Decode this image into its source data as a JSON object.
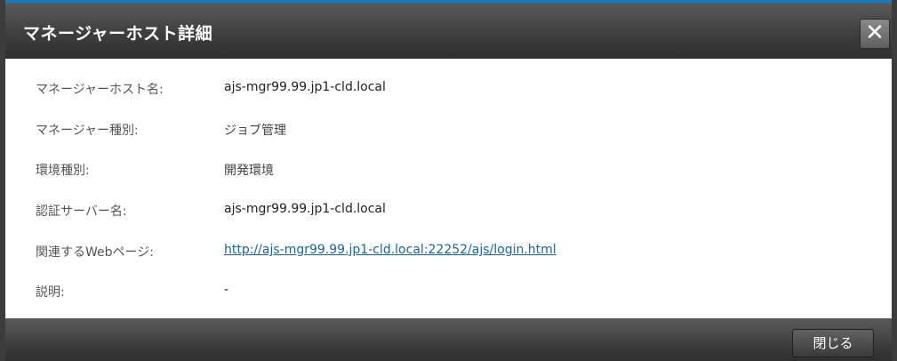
{
  "dialog": {
    "title": "マネージャーホスト詳細",
    "close_icon": "close-icon",
    "close_glyph": "✕",
    "close_button_label": "閉じる"
  },
  "details": [
    {
      "label": "マネージャーホスト名:",
      "value": "ajs-mgr99.99.jp1-cld.local"
    },
    {
      "label": "マネージャー種別:",
      "value": "ジョブ管理"
    },
    {
      "label": "環境種別:",
      "value": "開発環境"
    },
    {
      "label": "認証サーバー名:",
      "value": "ajs-mgr99.99.jp1-cld.local"
    },
    {
      "label": "関連するWebページ:",
      "value": "http://ajs-mgr99.99.jp1-cld.local:22252/ajs/login.html"
    },
    {
      "label": "説明:",
      "value": "-"
    }
  ],
  "colors": {
    "title_bar": "#3f3f3f",
    "accent_top": "#0d7ec7",
    "link": "#1565b0"
  }
}
